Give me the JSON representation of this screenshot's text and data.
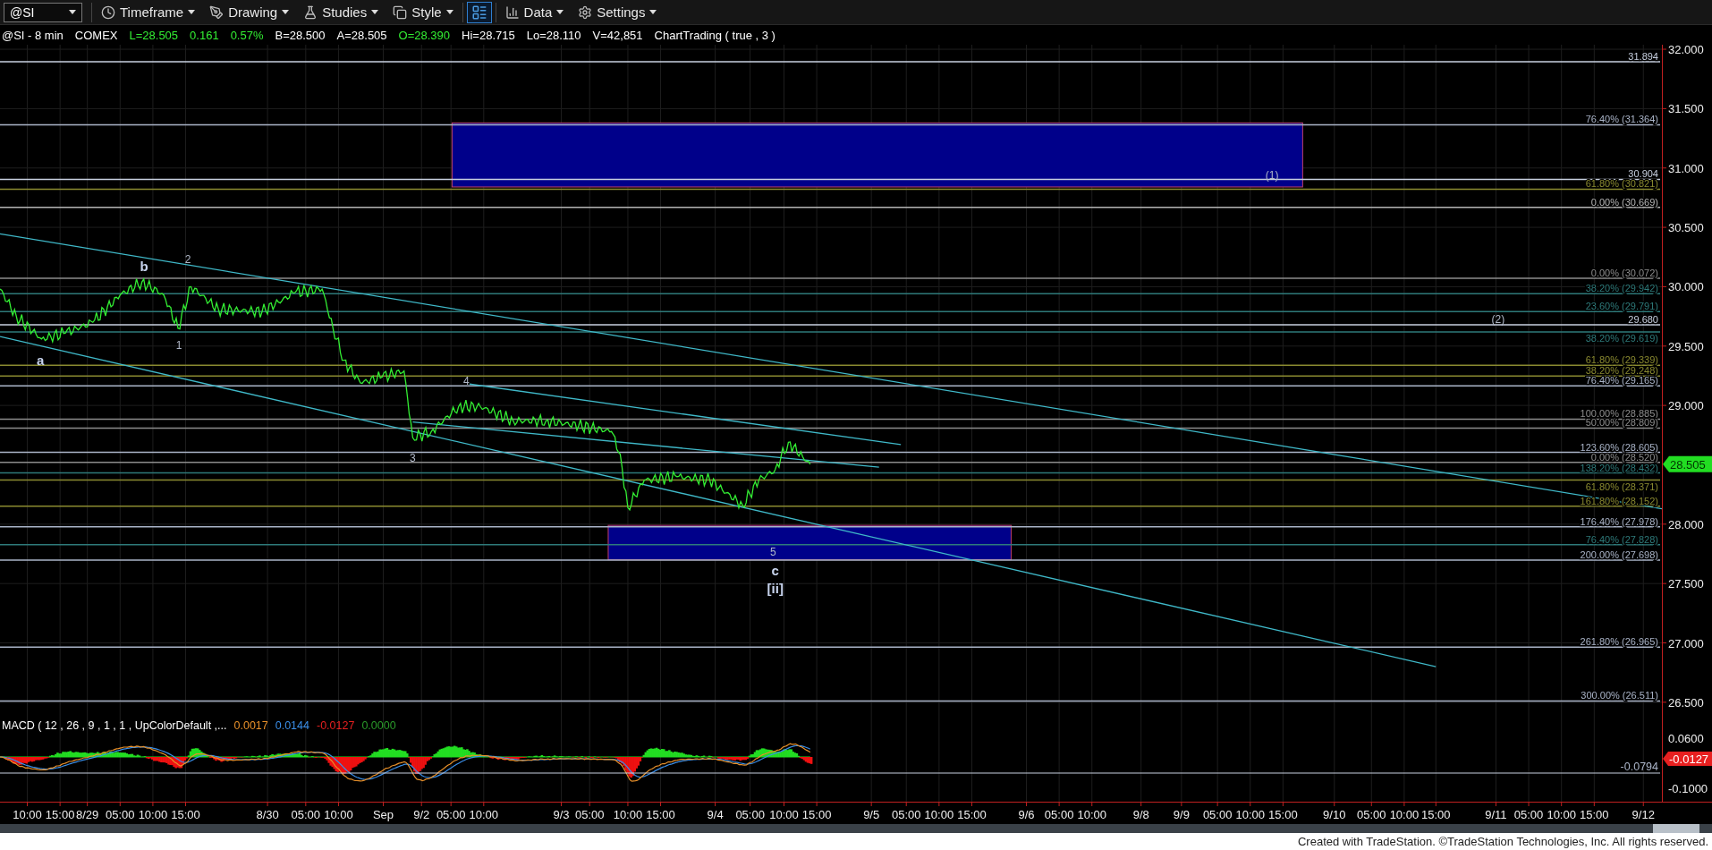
{
  "toolbar": {
    "symbol_field": {
      "value": "@SI"
    },
    "menus": [
      {
        "label": "Timeframe"
      },
      {
        "label": "Drawing"
      },
      {
        "label": "Studies"
      },
      {
        "label": "Style"
      }
    ],
    "layout_toggle": {
      "selected": true
    },
    "menus_right": [
      {
        "label": "Data"
      },
      {
        "label": "Settings"
      }
    ]
  },
  "info_line": [
    {
      "text": "@SI - 8 min",
      "color": "#ffffff"
    },
    {
      "text": "COMEX",
      "color": "#ffffff"
    },
    {
      "text": "L=28.505",
      "color": "#33ee33"
    },
    {
      "text": "0.161",
      "color": "#33ee33"
    },
    {
      "text": "0.57%",
      "color": "#33ee33"
    },
    {
      "text": "B=28.500",
      "color": "#ffffff"
    },
    {
      "text": "A=28.505",
      "color": "#ffffff"
    },
    {
      "text": "O=28.390",
      "color": "#33ee33"
    },
    {
      "text": "Hi=28.715",
      "color": "#ffffff"
    },
    {
      "text": "Lo=28.110",
      "color": "#ffffff"
    },
    {
      "text": "V=42,851",
      "color": "#ffffff"
    },
    {
      "text": "ChartTrading ( true , 3 )",
      "color": "#ffffff"
    }
  ],
  "price_chart": {
    "price_axis": [
      "32.000",
      "31.500",
      "31.000",
      "30.500",
      "30.000",
      "29.500",
      "29.000",
      "28.000",
      "27.500",
      "27.000",
      "26.500"
    ],
    "last_price": "28.505",
    "levels": [
      {
        "label": "31.894",
        "color": "#c8d0e0"
      },
      {
        "label": "76.40% (31.364)",
        "color": "#aab4c8"
      },
      {
        "label": "30.904",
        "color": "#c8d0e0"
      },
      {
        "label": "61.80% (30.821)",
        "color": "#8a8a30"
      },
      {
        "label": "0.00% (30.669)",
        "color": "#b4b4b4"
      },
      {
        "label": "0.00% (30.072)",
        "color": "#8c8c8c"
      },
      {
        "label": "38.20% (29.942)",
        "color": "#2e7a7a"
      },
      {
        "label": "23.60% (29.791)",
        "color": "#2e7a7a"
      },
      {
        "label": "29.680",
        "color": "#c8d0e0"
      },
      {
        "label": "38.20% (29.619)",
        "color": "#2e7a7a"
      },
      {
        "label": "61.80% (29.339)",
        "color": "#8a8a30"
      },
      {
        "label": "38.20% (29.248)",
        "color": "#8a8a30"
      },
      {
        "label": "76.40% (29.165)",
        "color": "#aab4c8"
      },
      {
        "label": "100.00% (28.885)",
        "color": "#8c8c8c"
      },
      {
        "label": "50.00% (28.809)",
        "color": "#8c8c8c"
      },
      {
        "label": "123.60% (28.605)",
        "color": "#aab4c8"
      },
      {
        "label": "0.00% (28.520)",
        "color": "#8c8c8c"
      },
      {
        "label": "138.20% (28.432)",
        "color": "#2e7a7a"
      },
      {
        "label": "61.80% (28.371)",
        "color": "#8a8a30"
      },
      {
        "label": "161.80% (28.152)",
        "color": "#8a8a30"
      },
      {
        "label": "176.40% (27.978)",
        "color": "#aab4c8"
      },
      {
        "label": "76.40% (27.828)",
        "color": "#2e7a7a"
      },
      {
        "label": "200.00% (27.698)",
        "color": "#aab4c8"
      },
      {
        "label": "261.80% (26.965)",
        "color": "#aab4c8"
      },
      {
        "label": "300.00% (26.511)",
        "color": "#aab4c8"
      }
    ],
    "wave_labels": [
      {
        "text": "a",
        "kind": "major"
      },
      {
        "text": "b",
        "kind": "major"
      },
      {
        "text": "2",
        "kind": "minor"
      },
      {
        "text": "1",
        "kind": "minor"
      },
      {
        "text": "3",
        "kind": "minor"
      },
      {
        "text": "4",
        "kind": "minor"
      },
      {
        "text": "5",
        "kind": "minor"
      },
      {
        "text": "c",
        "kind": "major"
      },
      {
        "text": "[ii]",
        "kind": "major"
      },
      {
        "text": "(1)",
        "kind": "minor"
      },
      {
        "text": "(2)",
        "kind": "minor"
      }
    ]
  },
  "macd": {
    "legend": [
      {
        "text": "MACD ( 12 , 26 , 9 , 1 , 1 , UpColorDefault ,...",
        "color": "#ffffff"
      },
      {
        "text": "0.0017",
        "color": "#e8902a"
      },
      {
        "text": "0.0144",
        "color": "#3a8ee8"
      },
      {
        "text": "-0.0127",
        "color": "#e82020"
      },
      {
        "text": "0.0000",
        "color": "#2a9a2a"
      }
    ],
    "axis_labels": [
      "0.0600",
      "-0.1000"
    ],
    "last_value": "-0.0127",
    "reference_line": "-0.0794"
  },
  "time_axis": [
    "10:00",
    "15:00",
    "8/29",
    "05:00",
    "10:00",
    "15:00",
    "8/30",
    "05:00",
    "10:00",
    "Sep",
    "9/2",
    "05:00",
    "10:00",
    "9/3",
    "05:00",
    "10:00",
    "15:00",
    "9/4",
    "05:00",
    "10:00",
    "15:00",
    "9/5",
    "05:00",
    "10:00",
    "15:00",
    "9/6",
    "05:00",
    "10:00",
    "9/8",
    "9/9",
    "05:00",
    "10:00",
    "15:00",
    "9/10",
    "05:00",
    "10:00",
    "15:00",
    "9/11",
    "05:00",
    "10:00",
    "15:00",
    "9/12"
  ],
  "footer": "Created with TradeStation. ©TradeStation Technologies, Inc. All rights reserved."
}
